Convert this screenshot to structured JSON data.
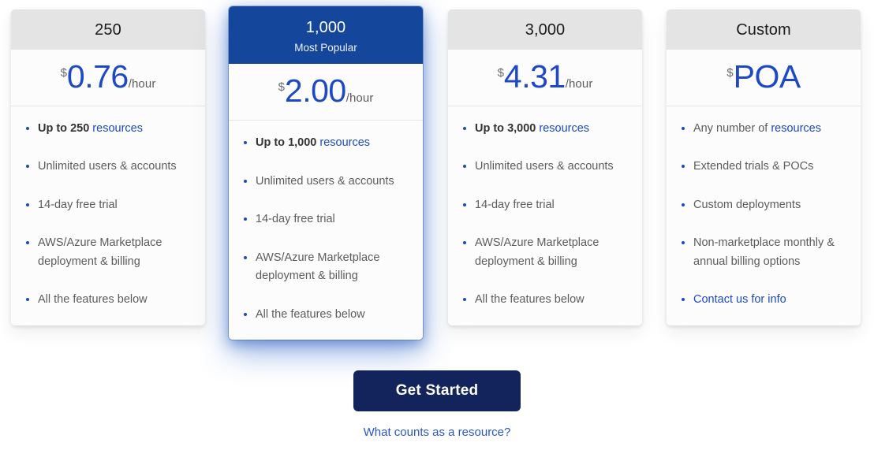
{
  "plans": [
    {
      "title": "250",
      "subtitle": "",
      "featured": false,
      "price": {
        "currency": "$",
        "value": "0.76",
        "unit": "/hour"
      },
      "features": [
        {
          "text": "Up to 250 ",
          "highlight": "resources",
          "strong": true,
          "link": false
        },
        {
          "text": "Unlimited users & accounts",
          "highlight": "",
          "strong": false,
          "link": false
        },
        {
          "text": "14-day free trial",
          "highlight": "",
          "strong": false,
          "link": false
        },
        {
          "text": "AWS/Azure Marketplace deployment & billing",
          "highlight": "",
          "strong": false,
          "link": false
        },
        {
          "text": "All the features below",
          "highlight": "",
          "strong": false,
          "link": false
        }
      ]
    },
    {
      "title": "1,000",
      "subtitle": "Most Popular",
      "featured": true,
      "price": {
        "currency": "$",
        "value": "2.00",
        "unit": "/hour"
      },
      "features": [
        {
          "text": "Up to 1,000 ",
          "highlight": "resources",
          "strong": true,
          "link": false
        },
        {
          "text": "Unlimited users & accounts",
          "highlight": "",
          "strong": false,
          "link": false
        },
        {
          "text": "14-day free trial",
          "highlight": "",
          "strong": false,
          "link": false
        },
        {
          "text": "AWS/Azure Marketplace deployment & billing",
          "highlight": "",
          "strong": false,
          "link": false
        },
        {
          "text": "All the features below",
          "highlight": "",
          "strong": false,
          "link": false
        }
      ]
    },
    {
      "title": "3,000",
      "subtitle": "",
      "featured": false,
      "price": {
        "currency": "$",
        "value": "4.31",
        "unit": "/hour"
      },
      "features": [
        {
          "text": "Up to 3,000 ",
          "highlight": "resources",
          "strong": true,
          "link": false
        },
        {
          "text": "Unlimited users & accounts",
          "highlight": "",
          "strong": false,
          "link": false
        },
        {
          "text": "14-day free trial",
          "highlight": "",
          "strong": false,
          "link": false
        },
        {
          "text": "AWS/Azure Marketplace deployment & billing",
          "highlight": "",
          "strong": false,
          "link": false
        },
        {
          "text": "All the features below",
          "highlight": "",
          "strong": false,
          "link": false
        }
      ]
    },
    {
      "title": "Custom",
      "subtitle": "",
      "featured": false,
      "price": {
        "currency": "$",
        "value": "POA",
        "unit": ""
      },
      "features": [
        {
          "text": "Any number of ",
          "highlight": "resources",
          "strong": false,
          "link": false
        },
        {
          "text": "Extended trials & POCs",
          "highlight": "",
          "strong": false,
          "link": false
        },
        {
          "text": "Custom deployments",
          "highlight": "",
          "strong": false,
          "link": false
        },
        {
          "text": "Non-marketplace monthly & annual billing options",
          "highlight": "",
          "strong": false,
          "link": false
        },
        {
          "text": "Contact us for info",
          "highlight": "",
          "strong": false,
          "link": true
        }
      ]
    }
  ],
  "cta": {
    "button_label": "Get Started",
    "link_label": "What counts as a resource?"
  },
  "colors": {
    "brand_blue": "#14469c",
    "price_blue": "#1d49c6",
    "cta_navy": "#13235b",
    "head_gray": "#e4e4e4",
    "body_text": "#5c5c5c"
  }
}
